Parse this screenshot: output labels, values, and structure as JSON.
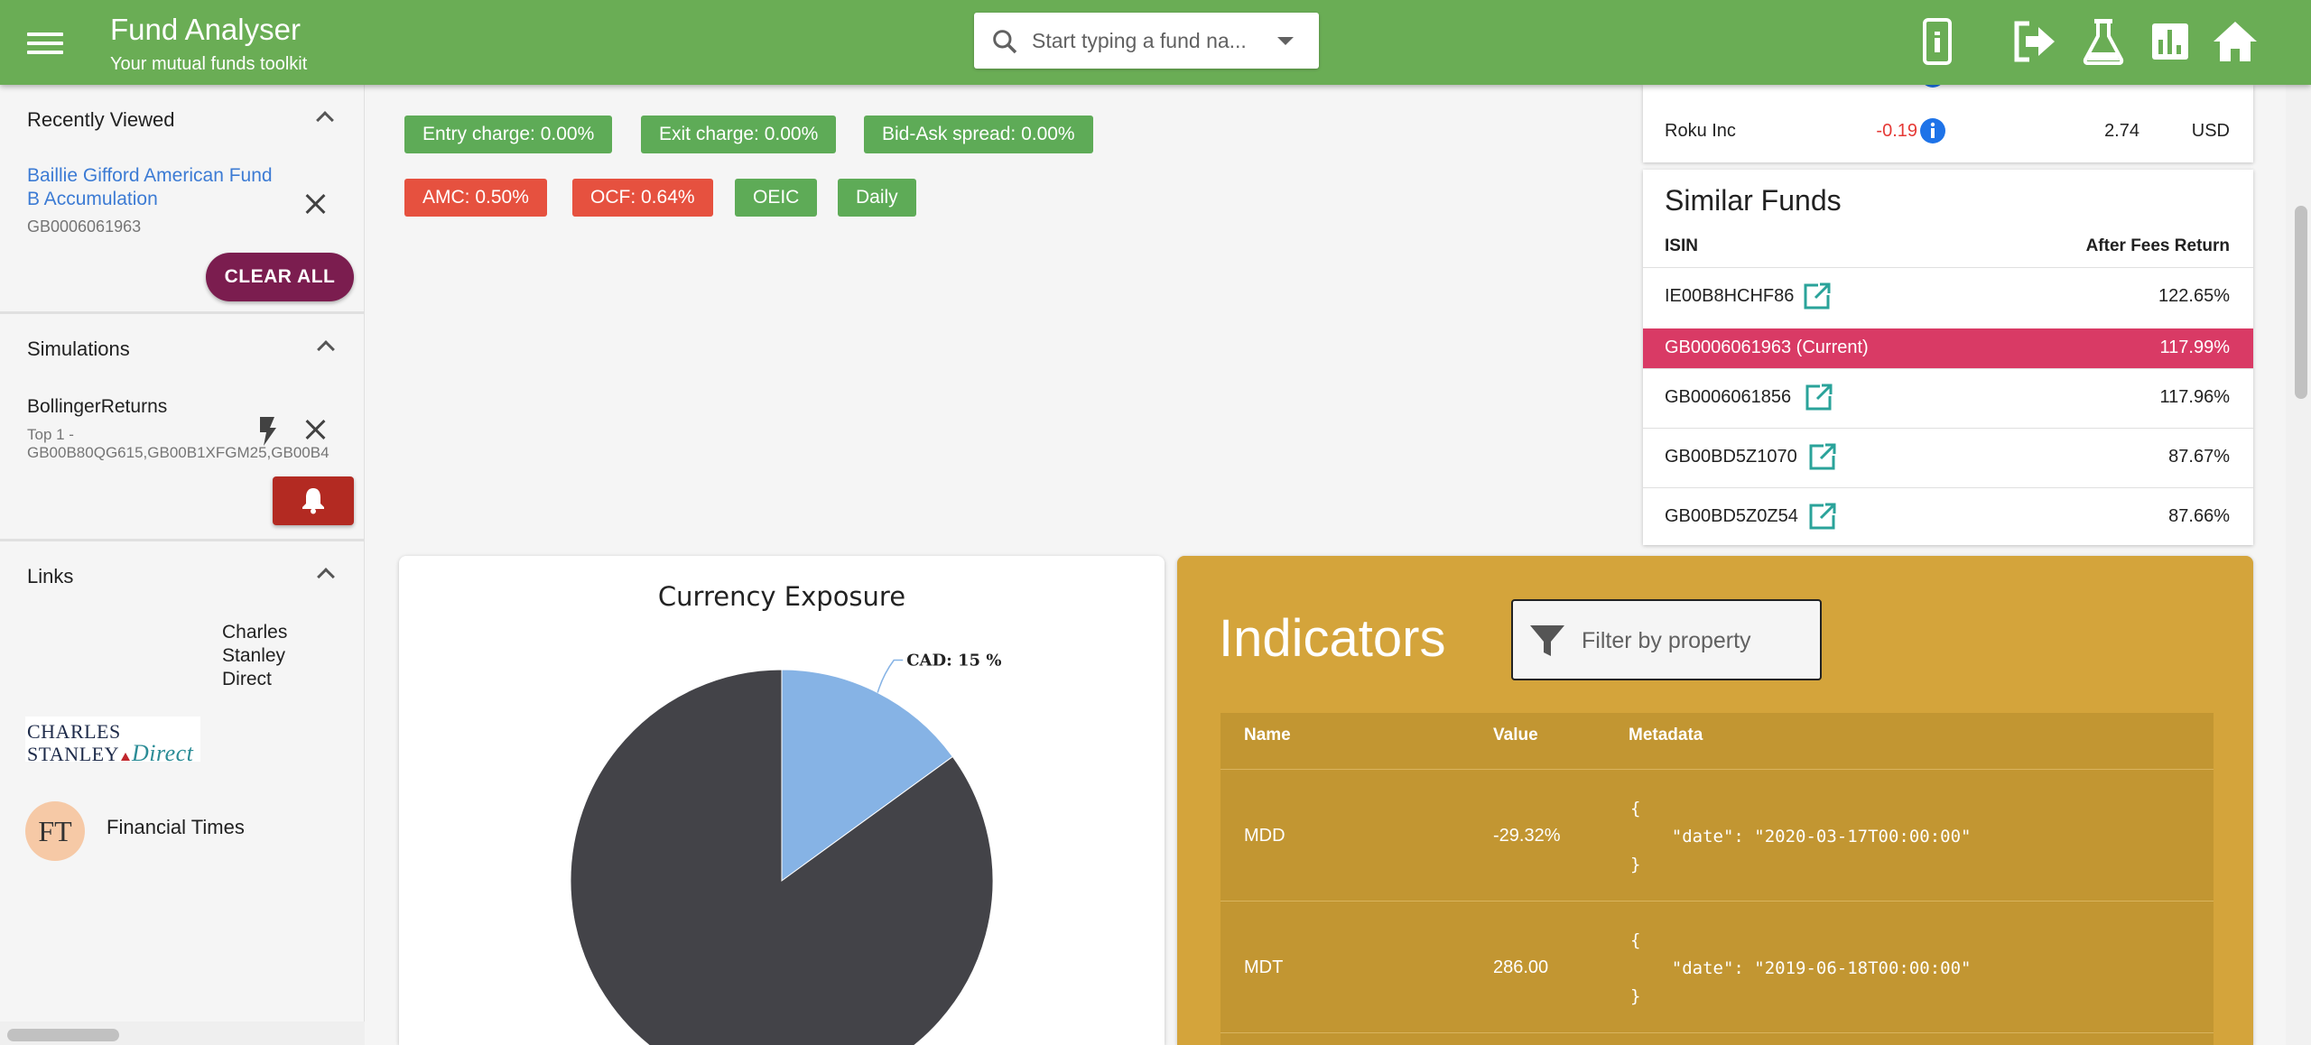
{
  "app": {
    "title": "Fund Analyser",
    "subtitle": "Your mutual funds toolkit",
    "search_placeholder": "Start typing a fund na...",
    "accent_color": "#6aad55",
    "icons": [
      "menu-icon",
      "search-icon",
      "chevron-down-icon",
      "phone-icon",
      "logout-icon",
      "flask-icon",
      "bar-chart-icon",
      "home-icon"
    ]
  },
  "sidebar": {
    "recently_viewed": {
      "header": "Recently Viewed",
      "fund_name": "Baillie Gifford American Fund B Accumulation",
      "isin": "GB0006061963",
      "clear_all": "CLEAR ALL"
    },
    "simulations": {
      "header": "Simulations",
      "name": "BollingerReturns",
      "description_line1": "Top 1 -",
      "description_line2": "GB00B80QG615,GB00B1XFGM25,GB00B4"
    },
    "links": {
      "header": "Links",
      "charles_stanley_logo": {
        "line1": "CHARLES",
        "line2": "STANLEY",
        "direct": "Direct"
      },
      "charles_stanley": "Charles Stanley Direct",
      "ft_logo": "FT",
      "ft": "Financial Times"
    }
  },
  "chips": {
    "entry": "Entry charge: 0.00%",
    "exit": "Exit charge: 0.00%",
    "spread": "Bid-Ask spread: 0.00%",
    "amc": "AMC: 0.50%",
    "ocf": "OCF: 0.64%",
    "type": "OEIC",
    "frequency": "Daily"
  },
  "holding": {
    "name": "Roku Inc",
    "change": "-0.19",
    "weight": "2.74",
    "currency": "USD"
  },
  "similar_funds": {
    "title": "Similar Funds",
    "col_isin": "ISIN",
    "col_return": "After Fees Return",
    "rows": [
      {
        "isin": "IE00B8HCHF86",
        "ret": "122.65%"
      },
      {
        "isin": "GB0006061963 (Current)",
        "ret": "117.99%"
      },
      {
        "isin": "GB0006061856",
        "ret": "117.96%"
      },
      {
        "isin": "GB00BD5Z1070",
        "ret": "87.67%"
      },
      {
        "isin": "GB00BD5Z0Z54",
        "ret": "87.66%"
      }
    ]
  },
  "currency_exposure": {
    "title": "Currency Exposure"
  },
  "chart_data": {
    "type": "pie",
    "title": "Currency Exposure",
    "slices": [
      {
        "name": "CAD",
        "value": 15,
        "label": "CAD: 15 %",
        "color": "#86b3e5"
      },
      {
        "name": "",
        "value": 85,
        "label": "",
        "color": "#434348"
      }
    ]
  },
  "indicators": {
    "title": "Indicators",
    "filter_placeholder": "Filter by property",
    "col_name": "Name",
    "col_value": "Value",
    "col_meta": "Metadata",
    "rows": [
      {
        "name": "MDD",
        "value": "-29.32%",
        "meta": "{\n    \"date\": \"2020-03-17T00:00:00\"\n}"
      },
      {
        "name": "MDT",
        "value": "286.00",
        "meta": "{\n    \"date\": \"2019-06-18T00:00:00\"\n}"
      }
    ]
  }
}
